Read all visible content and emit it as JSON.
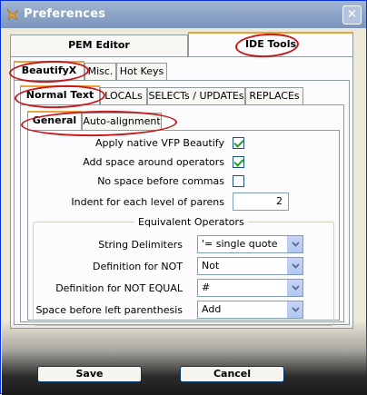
{
  "window": {
    "title": "Preferences",
    "close_glyph": "✕"
  },
  "top_tabs": [
    {
      "label": "PEM Editor",
      "active": false
    },
    {
      "label": "IDE Tools",
      "active": true
    }
  ],
  "second_tabs": [
    {
      "label": "BeautifyX",
      "active": true
    },
    {
      "label": "Misc.",
      "active": false
    },
    {
      "label": "Hot Keys",
      "active": false
    }
  ],
  "third_tabs": [
    {
      "label": "Normal Text",
      "active": true
    },
    {
      "label": "LOCALs",
      "active": false
    },
    {
      "label": "SELECTs / UPDATEs",
      "active": false
    },
    {
      "label": "REPLACEs",
      "active": false
    }
  ],
  "fourth_tabs": [
    {
      "label": "General",
      "active": true
    },
    {
      "label": "Auto-alignment",
      "active": false
    }
  ],
  "options": {
    "apply_native": {
      "label": "Apply native VFP Beautify",
      "checked": true
    },
    "space_around_ops": {
      "label": "Add space around operators",
      "checked": true
    },
    "no_space_commas": {
      "label": "No space before commas",
      "checked": false
    },
    "indent_parens": {
      "label": "Indent for each level of parens",
      "value": "2"
    }
  },
  "equivalent_operators": {
    "title": "Equivalent Operators",
    "string_delimiters": {
      "label": "String Delimiters",
      "value": "'= single quote"
    },
    "not": {
      "label": "Definition for NOT",
      "value": "Not"
    },
    "not_equal": {
      "label": "Definition for NOT EQUAL",
      "value": "#"
    },
    "space_left_paren": {
      "label": "Space before left parenthesis",
      "value": "Add"
    }
  },
  "buttons": {
    "save": "Save",
    "cancel": "Cancel"
  },
  "colors": {
    "annotation": "#c41a1a",
    "check": "#21a121",
    "active_tab_accent": "#e8a33f"
  }
}
